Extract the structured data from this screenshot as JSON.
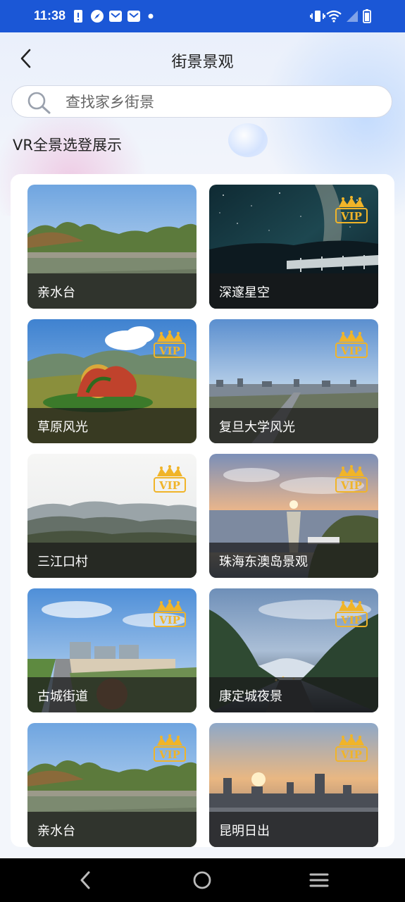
{
  "status_bar": {
    "time": "11:38",
    "icons_left": [
      "alert-icon",
      "compass-icon",
      "mail-icon",
      "mail-icon",
      "dot-icon"
    ],
    "icons_right": [
      "vibrate-icon",
      "wifi-icon",
      "signal-icon",
      "battery-icon"
    ]
  },
  "header": {
    "title": "街景景观",
    "back_icon": "chevron-left-icon"
  },
  "search": {
    "placeholder": "查找家乡街景",
    "value": ""
  },
  "section": {
    "title": "VR全景选登展示"
  },
  "tiles": [
    {
      "label": "亲水台",
      "vip": false,
      "scene": "lake-park"
    },
    {
      "label": "深邃星空",
      "vip": true,
      "scene": "starry-sky"
    },
    {
      "label": "草原风光",
      "vip": true,
      "scene": "grassland-sculpture"
    },
    {
      "label": "复旦大学风光",
      "vip": true,
      "scene": "city-aerial"
    },
    {
      "label": "三江口村",
      "vip": true,
      "scene": "misty-mountains"
    },
    {
      "label": "珠海东澳岛景观",
      "vip": true,
      "scene": "island-sunset"
    },
    {
      "label": "古城街道",
      "vip": true,
      "scene": "old-town-street"
    },
    {
      "label": "康定城夜景",
      "vip": true,
      "scene": "valley-night"
    },
    {
      "label": "亲水台",
      "vip": true,
      "scene": "lake-park"
    },
    {
      "label": "昆明日出",
      "vip": true,
      "scene": "city-sunrise"
    }
  ],
  "vip_badge": {
    "text": "VIP",
    "color": "#f0b429"
  },
  "nav_bar": {
    "buttons": [
      "back-nav-icon",
      "home-nav-icon",
      "menu-nav-icon"
    ]
  },
  "colors": {
    "status_bar": "#1b57d6",
    "caption_bg": "#191919"
  }
}
